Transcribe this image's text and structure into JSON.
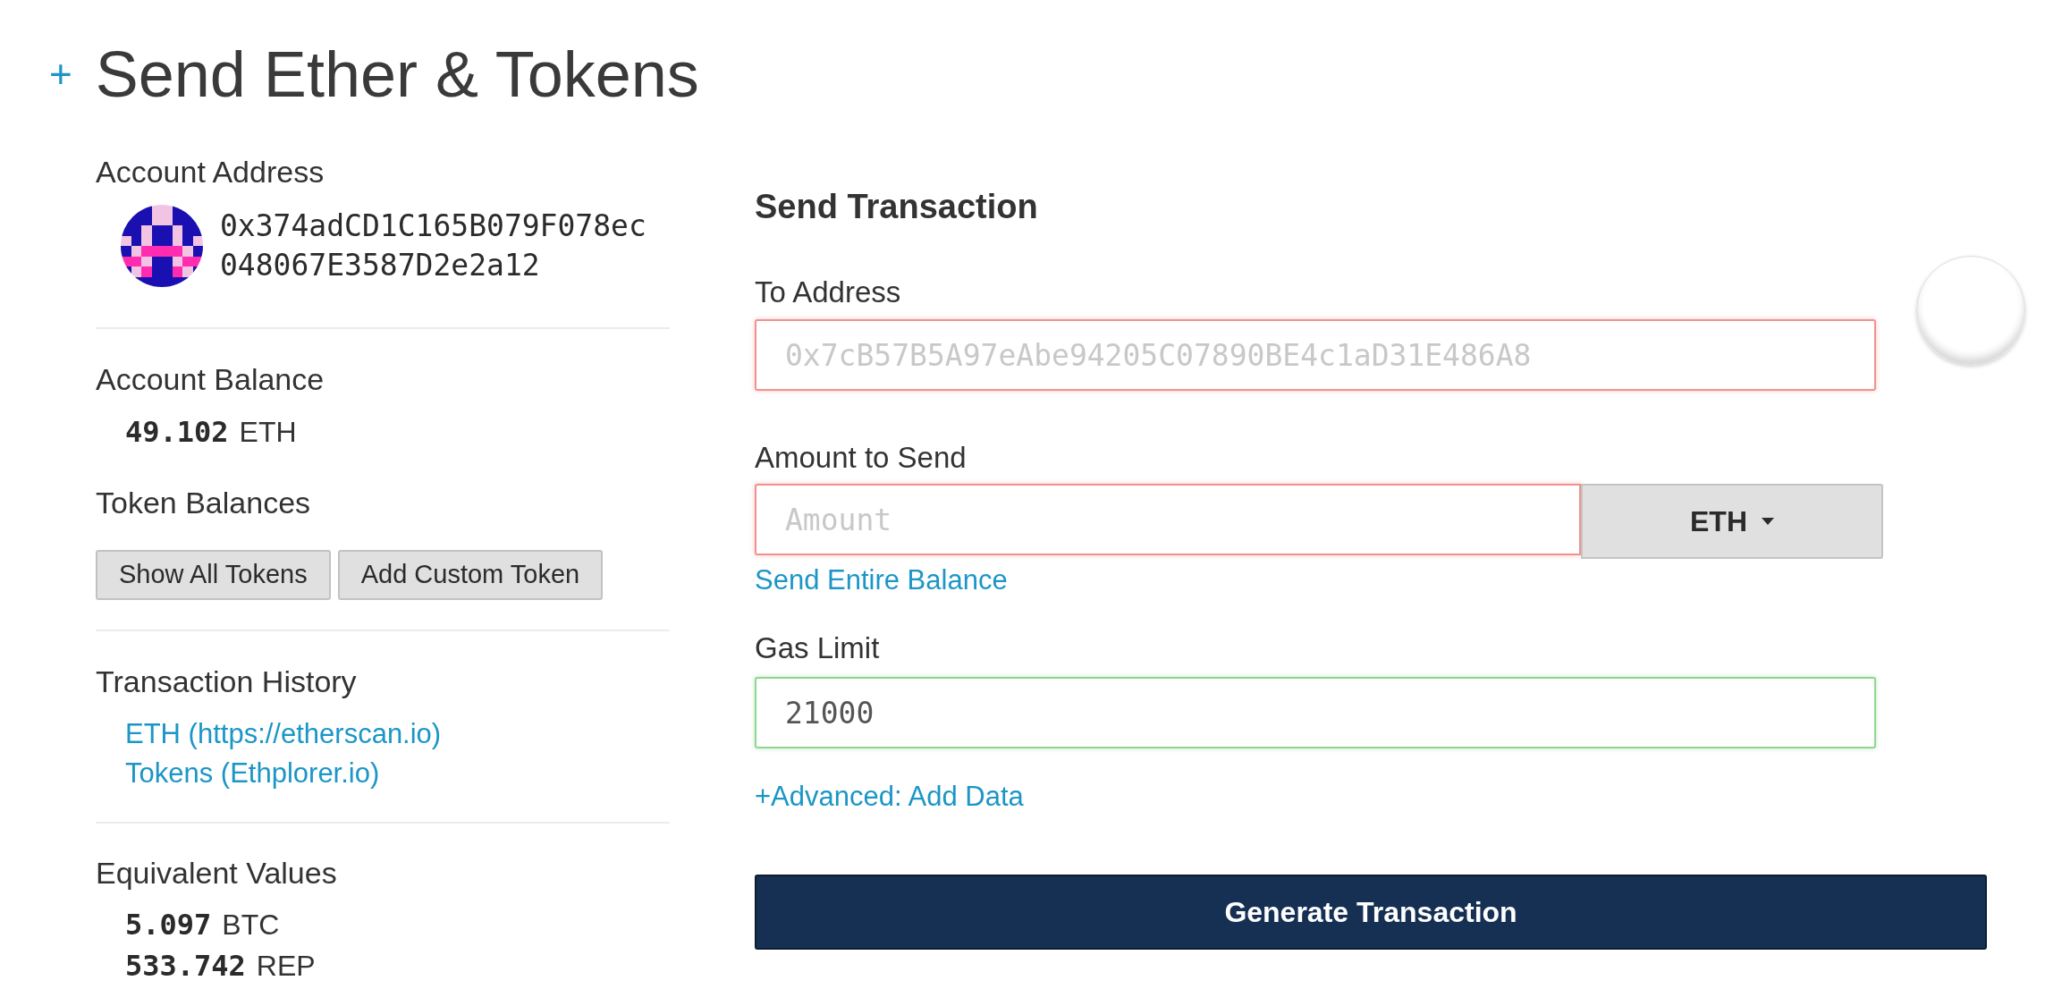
{
  "header": {
    "toggle": "+",
    "title": "Send Ether & Tokens"
  },
  "account": {
    "address_label": "Account Address",
    "address": "0x374adCD1C165B079F078ec048067E3587D2e2a12",
    "balance_label": "Account Balance",
    "balance": {
      "amount": "49.102",
      "unit": "ETH"
    },
    "token_label": "Token Balances",
    "token_buttons": [
      "Show All Tokens",
      "Add Custom Token"
    ],
    "history_label": "Transaction History",
    "history_links": [
      "ETH (https://etherscan.io)",
      "Tokens (Ethplorer.io)"
    ],
    "equivalent_label": "Equivalent Values",
    "equivalents": [
      {
        "amount": "5.097",
        "unit": "BTC"
      },
      {
        "amount": "533.742",
        "unit": "REP"
      }
    ]
  },
  "send_form": {
    "title": "Send Transaction",
    "to_address": {
      "label": "To Address",
      "placeholder": "0x7cB57B5A97eAbe94205C07890BE4c1aD31E486A8",
      "valid": false
    },
    "amount": {
      "label": "Amount to Send",
      "placeholder": "Amount",
      "valid": false,
      "currency": "ETH",
      "entire_balance_link": "Send Entire Balance"
    },
    "gas_limit": {
      "label": "Gas Limit",
      "value": "21000",
      "valid": true
    },
    "advanced_link": "+Advanced: Add Data",
    "submit": "Generate Transaction"
  }
}
